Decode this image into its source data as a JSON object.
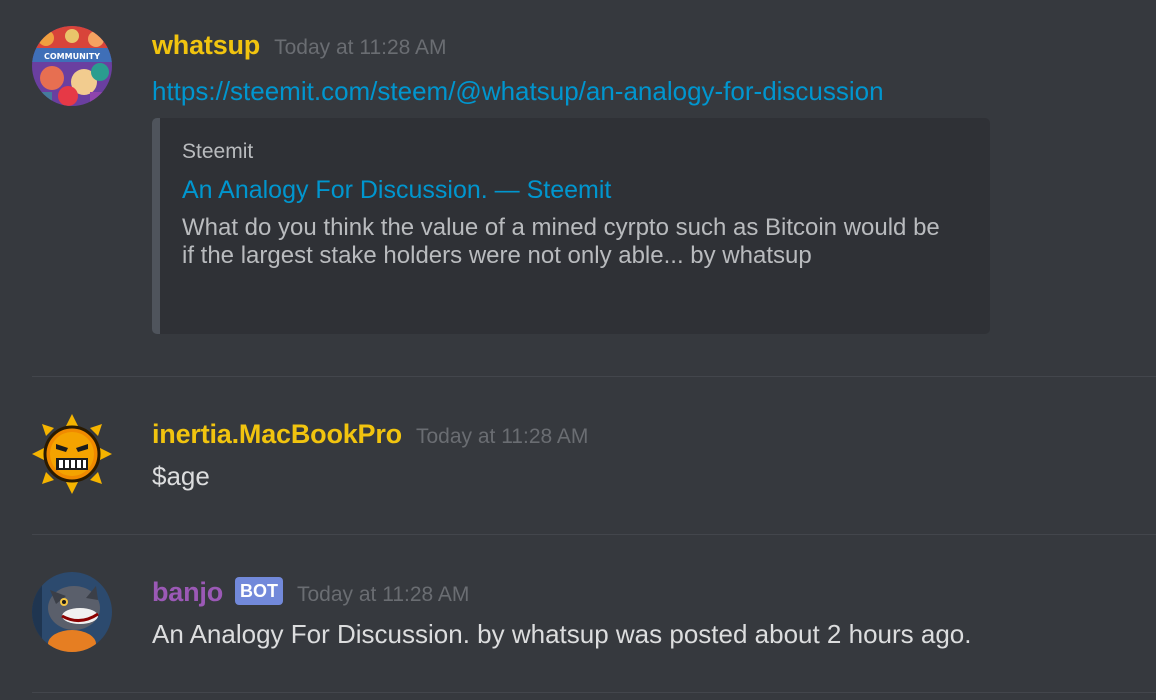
{
  "messages": [
    {
      "username": "whatsup",
      "username_color": "#f1c40f",
      "timestamp": "Today at 11:28 AM",
      "link": "https://steemit.com/steem/@whatsup/an-analogy-for-discussion",
      "embed": {
        "provider": "Steemit",
        "title": "An Analogy For Discussion. — Steemit",
        "description": "What do you think the value of a mined cyrpto such as Bitcoin would be if the largest stake holders were not only able... by whatsup"
      },
      "avatar_text": "COMMUNITY"
    },
    {
      "username": "inertia.MacBookPro",
      "username_color": "#f1c40f",
      "timestamp": "Today at 11:28 AM",
      "text": "$age"
    },
    {
      "username": "banjo",
      "username_color": "#9b59b6",
      "bot_tag": "BOT",
      "timestamp": "Today at 11:28 AM",
      "text": "An Analogy For Discussion. by whatsup was posted about 2 hours ago."
    }
  ],
  "colors": {
    "background": "#36393e",
    "link": "#0096cf",
    "embed_bg": "#2f3136",
    "bot_tag": "#7289da"
  }
}
